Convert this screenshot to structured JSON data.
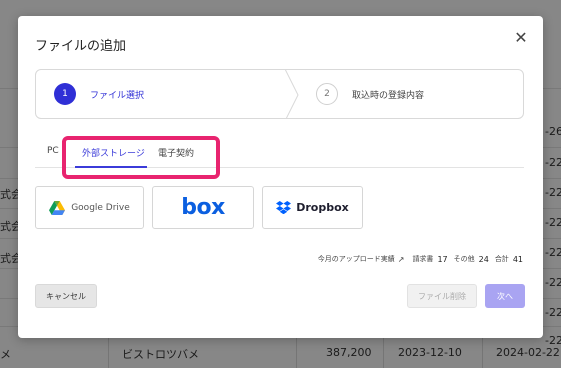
{
  "background": {
    "right_dates": [
      "-26",
      "-22",
      "-22",
      "-22",
      "-22",
      "-22",
      "-22",
      "-22"
    ],
    "left_fragments": [
      "式会",
      "式会",
      "式会"
    ],
    "bottom_row": [
      "メ",
      "ビストロツバメ",
      "387,200",
      "2023-12-10",
      "2024-02-22"
    ]
  },
  "modal": {
    "title": "ファイルの追加",
    "close_glyph": "✕",
    "steps": [
      {
        "number": "1",
        "label": "ファイル選択",
        "active": true
      },
      {
        "number": "2",
        "label": "取込時の登録内容",
        "active": false
      }
    ],
    "tabs": [
      {
        "label": "PC"
      },
      {
        "label": "外部ストレージ",
        "selected": true
      },
      {
        "label": "電子契約"
      }
    ],
    "providers": {
      "google_drive": "Google Drive",
      "box": "box",
      "dropbox": "Dropbox"
    },
    "stats": {
      "link_label": "今月のアップロード実績",
      "invoice_label": "請求書",
      "invoice_count": "17",
      "other_label": "その他",
      "other_count": "24",
      "total_label": "合計",
      "total_count": "41"
    },
    "buttons": {
      "cancel": "キャンセル",
      "delete": "ファイル削除",
      "next": "次へ"
    }
  },
  "colors": {
    "accent": "#2f2fd6",
    "highlight": "#e8246f",
    "next_button": "#a9a4f2",
    "box_brand": "#0b5fe0",
    "dropbox_brand": "#0061fe"
  }
}
